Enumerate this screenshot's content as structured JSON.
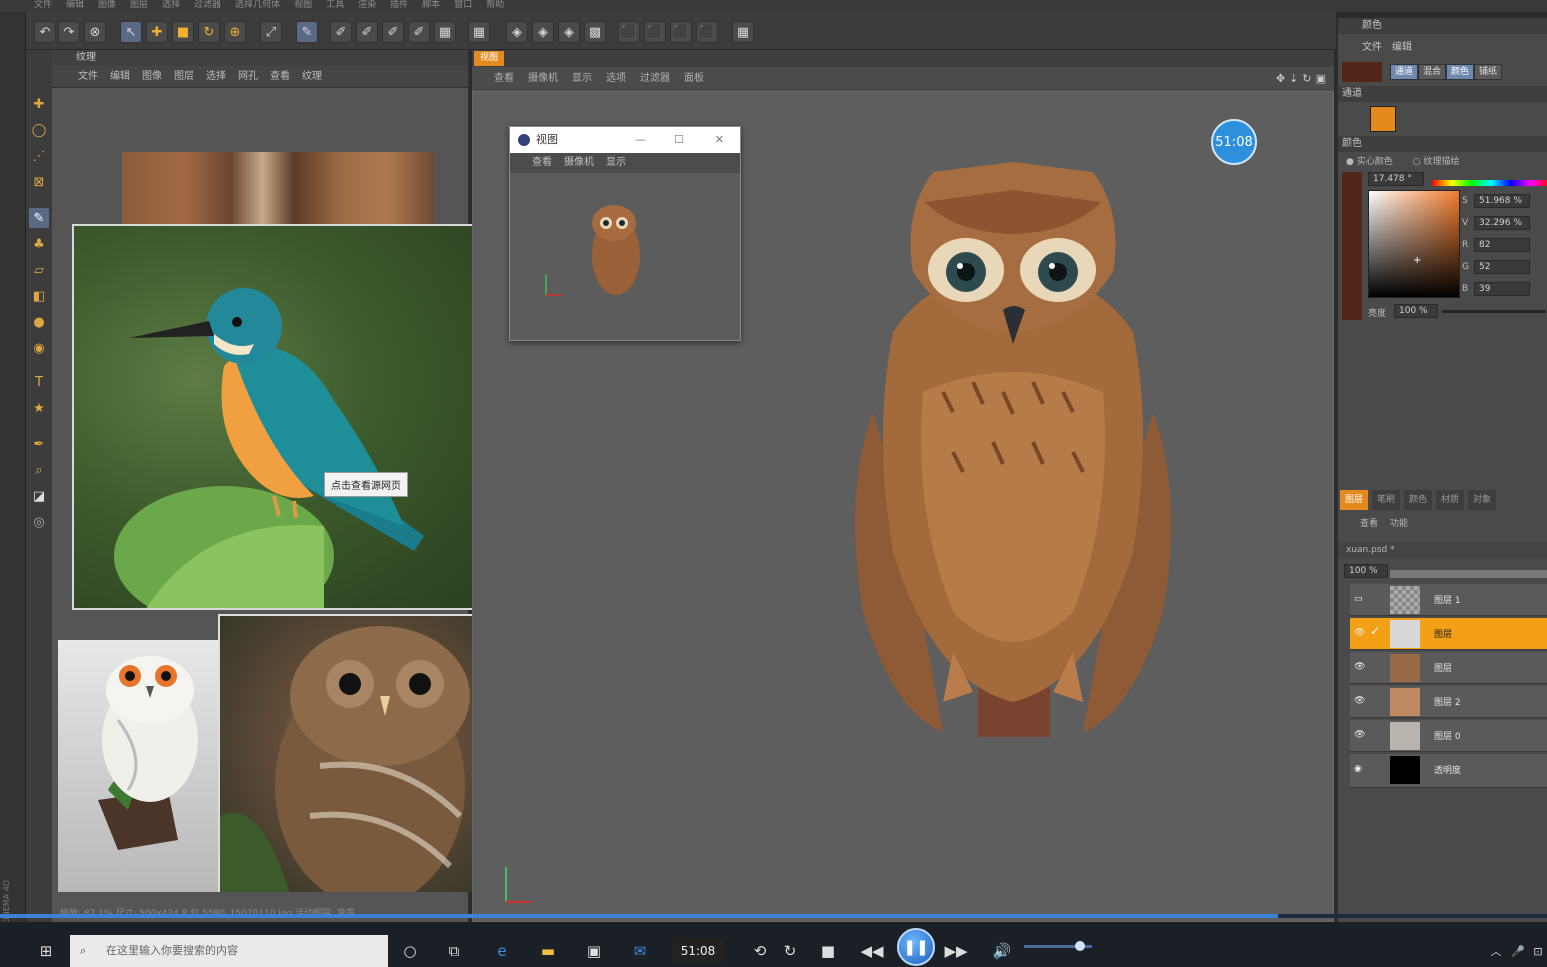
{
  "menubar": {
    "items": [
      "文件",
      "编辑",
      "图像",
      "图层",
      "选择",
      "过滤器",
      "选择几何体",
      "视图",
      "工具",
      "渲染",
      "插件",
      "脚本",
      "窗口",
      "帮助"
    ]
  },
  "texture_panel": {
    "title": "纹理",
    "menu": [
      "文件",
      "编辑",
      "图像",
      "图层",
      "选择",
      "网孔",
      "查看",
      "纹理"
    ],
    "status": "缩放: 87.1%  尺寸: 500x434  8 位  5590_15070110.jpg  活动图层: 背景"
  },
  "tooltip": {
    "text": "点击查看源网页"
  },
  "viewport": {
    "tab": "视图",
    "menu": [
      "查看",
      "摄像机",
      "显示",
      "选项",
      "过滤器",
      "面板"
    ]
  },
  "mini_window": {
    "title": "视图",
    "menu": [
      "查看",
      "摄像机",
      "显示"
    ]
  },
  "timer_badge": "51:08",
  "color_panel": {
    "title": "颜色",
    "menu": [
      "文件",
      "编辑"
    ],
    "channel_buttons": [
      "通道",
      "混合",
      "颜色",
      "铺纸"
    ],
    "channel_label": "通道",
    "color_label": "颜色",
    "mode_solid": "实心颜色",
    "mode_texture": "纹理描绘",
    "hue": "17.478 °",
    "s_label": "S",
    "s_value": "51.968 %",
    "v_label": "V",
    "v_value": "32.296 %",
    "r_label": "R",
    "r_value": "82",
    "g_label": "G",
    "g_value": "52",
    "b_label": "B",
    "b_value": "39",
    "brightness_label": "亮度",
    "brightness_value": "100 %",
    "swatch_color": "#52271a"
  },
  "layers_panel": {
    "tabs": [
      "图层",
      "笔刷",
      "颜色",
      "材质",
      "对象"
    ],
    "menu": [
      "查看",
      "功能"
    ],
    "file": "xuan.psd *",
    "opacity": "100 %",
    "layers": [
      {
        "name": "图层 1",
        "thumb": "checker"
      },
      {
        "name": "图层",
        "thumb": "light"
      },
      {
        "name": "图层",
        "thumb": "owl"
      },
      {
        "name": "图层 2",
        "thumb": "owl2"
      },
      {
        "name": "图层 0",
        "thumb": "owl3"
      },
      {
        "name": "透明度",
        "thumb": "black"
      }
    ],
    "selected_layer": 1
  },
  "taskbar": {
    "search_placeholder": "在这里输入你要搜索的内容",
    "time": "51:08"
  },
  "player": {
    "progress": 0.826,
    "volume": 0.82
  },
  "app_brand": "MAXON CINEMA 4D",
  "colors": {
    "accent_orange": "#e38a1e",
    "accent_blue": "#2e8fdc"
  }
}
